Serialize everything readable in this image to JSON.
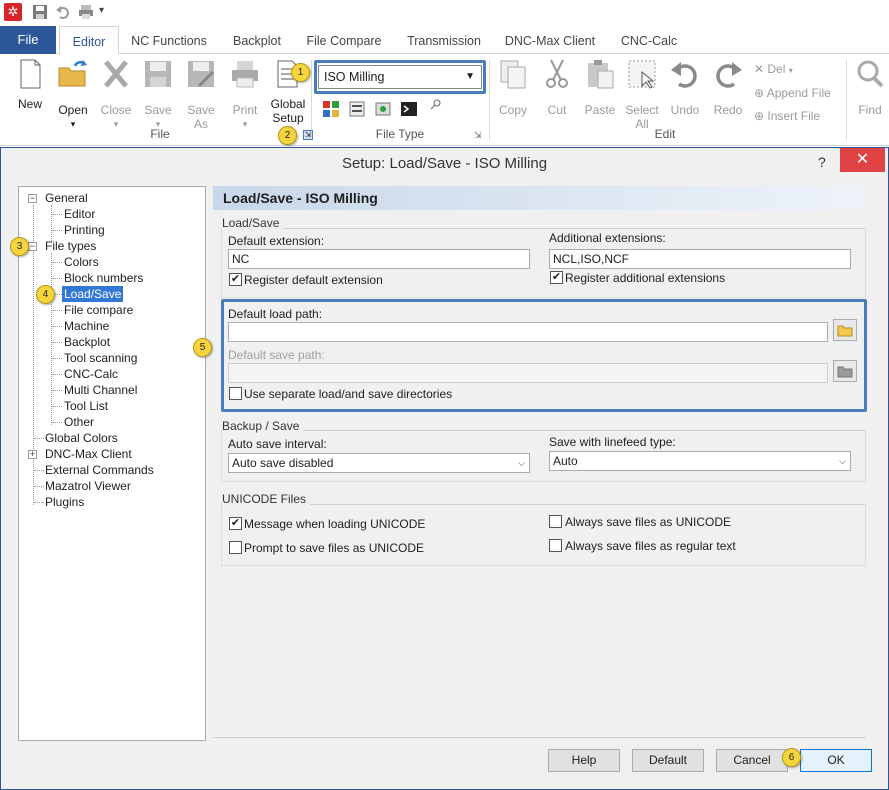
{
  "ribbon_tabs": [
    "File",
    "Editor",
    "NC Functions",
    "Backplot",
    "File Compare",
    "Transmission",
    "DNC-Max Client",
    "CNC-Calc"
  ],
  "ribbon": {
    "new": "New",
    "open": "Open",
    "close": "Close",
    "save": "Save",
    "save_as_1": "Save",
    "save_as_2": "As",
    "print": "Print",
    "global_setup_1": "Global",
    "global_setup_2": "Setup",
    "file_group": "File",
    "file_type_value": "ISO Milling",
    "file_type_group": "File Type",
    "copy": "Copy",
    "cut": "Cut",
    "paste": "Paste",
    "select_all_1": "Select",
    "select_all_2": "All",
    "undo": "Undo",
    "redo": "Redo",
    "edit_group": "Edit",
    "del": "Del",
    "append_file": "Append File",
    "insert_file": "Insert File",
    "find": "Find"
  },
  "badges": [
    "1",
    "2",
    "3",
    "4",
    "5",
    "6"
  ],
  "dialog": {
    "title": "Setup: Load/Save - ISO Milling",
    "help_glyph": "?",
    "close_glyph": "✕",
    "tree": [
      "General",
      "Editor",
      "Printing",
      "File types",
      "Colors",
      "Block numbers",
      "Load/Save",
      "File compare",
      "Machine",
      "Backplot",
      "Tool scanning",
      "CNC-Calc",
      "Multi Channel",
      "Tool List",
      "Other",
      "Global Colors",
      "DNC-Max Client",
      "External Commands",
      "Mazatrol Viewer",
      "Plugins"
    ],
    "panel_title": "Load/Save - ISO Milling",
    "load_save_group": "Load/Save",
    "default_extension_label": "Default extension:",
    "default_extension_value": "NC",
    "additional_extensions_label": "Additional extensions:",
    "additional_extensions_value": "NCL,ISO,NCF",
    "register_default": "Register default extension",
    "register_additional": "Register additional extensions",
    "default_load_path_label": "Default load path:",
    "default_load_path_value": "",
    "default_save_path_label": "Default save path:",
    "default_save_path_value": "",
    "separate_dirs": "Use separate load/and save directories",
    "backup_group": "Backup / Save",
    "auto_save_label": "Auto save interval:",
    "auto_save_value": "Auto save disabled",
    "linefeed_label": "Save with linefeed type:",
    "linefeed_value": "Auto",
    "unicode_group": "UNICODE Files",
    "msg_unicode": "Message when loading UNICODE",
    "prompt_unicode": "Prompt to save files as UNICODE",
    "always_unicode": "Always save files as UNICODE",
    "always_regular": "Always save files as regular text",
    "help_btn": "Help",
    "default_btn": "Default",
    "cancel_btn": "Cancel",
    "ok_btn": "OK"
  },
  "colors": {
    "accent": "#2b579a",
    "highlight": "#4a7cc0",
    "badge": "#f5d43c",
    "close": "#e04343"
  }
}
